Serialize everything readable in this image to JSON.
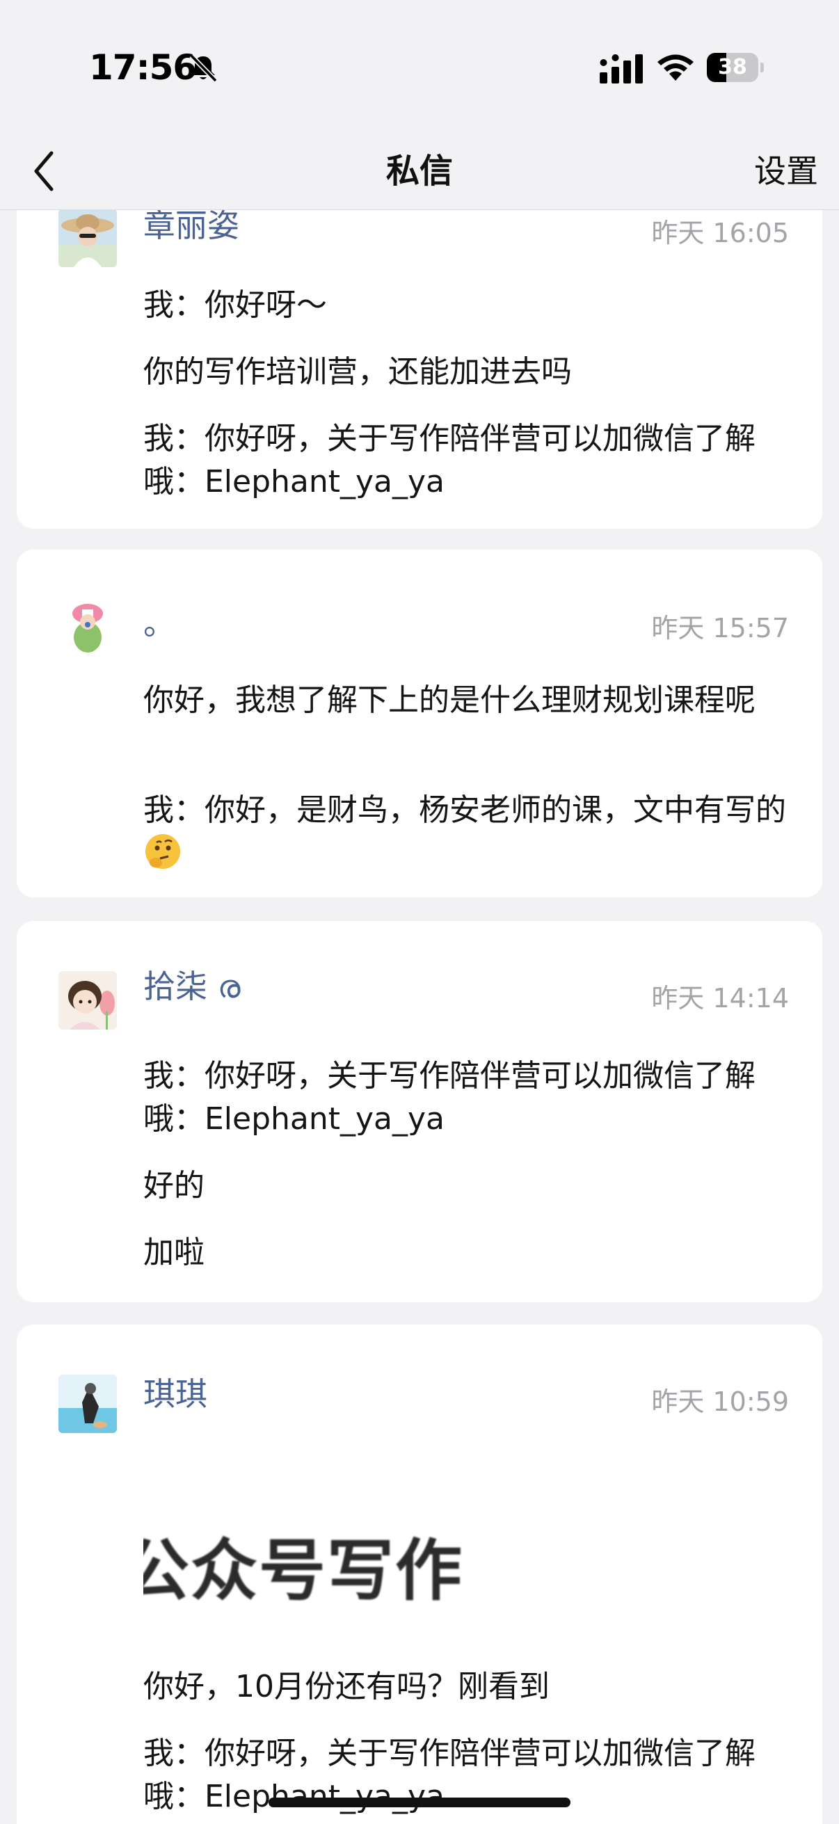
{
  "status_bar": {
    "time": "17:56",
    "battery_level": "38",
    "battery_fraction": 0.38,
    "icons": [
      "bell-slash-icon",
      "cellular-signal-icon",
      "wifi-icon",
      "battery-icon"
    ]
  },
  "nav": {
    "back_icon": "chevron-left-icon",
    "title": "私信",
    "settings_label": "设置"
  },
  "conversations": [
    {
      "name": "章丽姿",
      "time": "昨天 16:05",
      "messages": [
        "我：你好呀～",
        "你的写作培训营，还能加进去吗",
        "我：你好呀，关于写作陪伴营可以加微信了解哦：Elephant_ya_ya"
      ]
    },
    {
      "name": "。",
      "time": "昨天 15:57",
      "messages": [
        "你好，我想了解下上的是什么理财规划课程呢",
        "我：你好，是财鸟，杨安老师的课，文中有写的"
      ],
      "emoji": "thinking-face-emoji"
    },
    {
      "name": "拾柒",
      "name_suffix": "ര",
      "time": "昨天 14:14",
      "messages": [
        "我：你好呀，关于写作陪伴营可以加微信了解哦：Elephant_ya_ya",
        "好的",
        "加啦"
      ]
    },
    {
      "name": "琪琪",
      "time": "昨天 10:59",
      "image_text": "公众号写作",
      "messages": [
        "你好，10月份还有吗？刚看到",
        "我：你好呀，关于写作陪伴营可以加微信了解哦：Elephant_ya_ya"
      ]
    }
  ]
}
